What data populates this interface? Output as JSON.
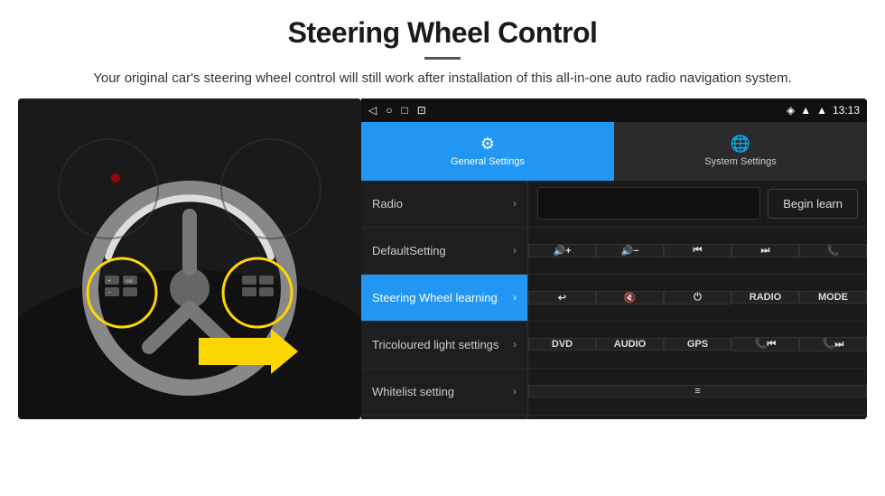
{
  "header": {
    "title": "Steering Wheel Control",
    "subtitle": "Your original car's steering wheel control will still work after installation of this all-in-one auto radio navigation system."
  },
  "status_bar": {
    "nav_back": "◁",
    "nav_home": "○",
    "nav_recents": "□",
    "nav_cast": "⊡",
    "signal": "▾",
    "wifi": "▾",
    "time": "13:13"
  },
  "tabs": {
    "general": {
      "icon": "⚙",
      "label": "General Settings"
    },
    "system": {
      "icon": "🌐",
      "label": "System Settings"
    }
  },
  "menu": {
    "items": [
      {
        "label": "Radio",
        "active": false
      },
      {
        "label": "DefaultSetting",
        "active": false
      },
      {
        "label": "Steering Wheel learning",
        "active": true
      },
      {
        "label": "Tricoloured light settings",
        "active": false
      },
      {
        "label": "Whitelist setting",
        "active": false
      }
    ]
  },
  "controls": {
    "begin_learn_label": "Begin learn",
    "row2": [
      "🔊+",
      "🔊−",
      "⏮",
      "⏭",
      "📞"
    ],
    "row2_labels": [
      "vol+",
      "vol-",
      "prev",
      "next",
      "call"
    ],
    "row3_labels": [
      "↩",
      "🔇x",
      "⏻",
      "RADIO",
      "MODE"
    ],
    "row4_labels": [
      "DVD",
      "AUDIO",
      "GPS",
      "📞⏮",
      "📞⏭"
    ],
    "row5_labels": [
      "≡"
    ]
  }
}
